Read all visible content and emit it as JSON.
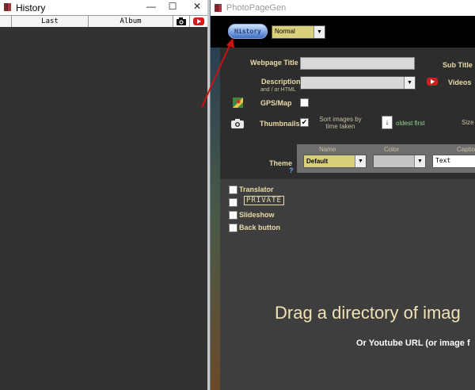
{
  "history_window": {
    "title": "History",
    "columns": [
      "Last loaded/modified",
      "Album"
    ],
    "caption_buttons": [
      "—",
      "☐",
      "✕"
    ]
  },
  "ppg_window": {
    "title": "PhotoPageGen",
    "history_button": "History",
    "mode_select": "Normal",
    "webpage_title_label": "Webpage Title",
    "sub_title_label": "Sub Title",
    "description_label": "Description",
    "description_sub": "and / or HTML",
    "videos_label": "Videos",
    "gps_label": "GPS/Map",
    "thumbnails_label": "Thumbnails",
    "sort_label": "Sort images by time taken",
    "oldest_first": "oldest first",
    "size_label": "Size",
    "theme_label": "Theme",
    "theme_help": "?",
    "theme_name_header": "Name",
    "theme_color_header": "Color",
    "theme_caption_header": "Caption",
    "theme_name_value": "Default",
    "theme_caption_value": "Text",
    "translator_label": "Translator",
    "private_label": "PRIVATE",
    "slideshow_label": "Slideshow",
    "back_button_label": "Back button",
    "drag_text": "Drag a directory of imag",
    "youtube_text": "Or Youtube URL (or image f",
    "sort_order_symbol": "↓"
  },
  "colors": {
    "label": "#e8dca8",
    "accent_blue": "#3d6fc4",
    "youtube_red": "#d21e1e",
    "annotation_arrow": "#cc1010"
  }
}
